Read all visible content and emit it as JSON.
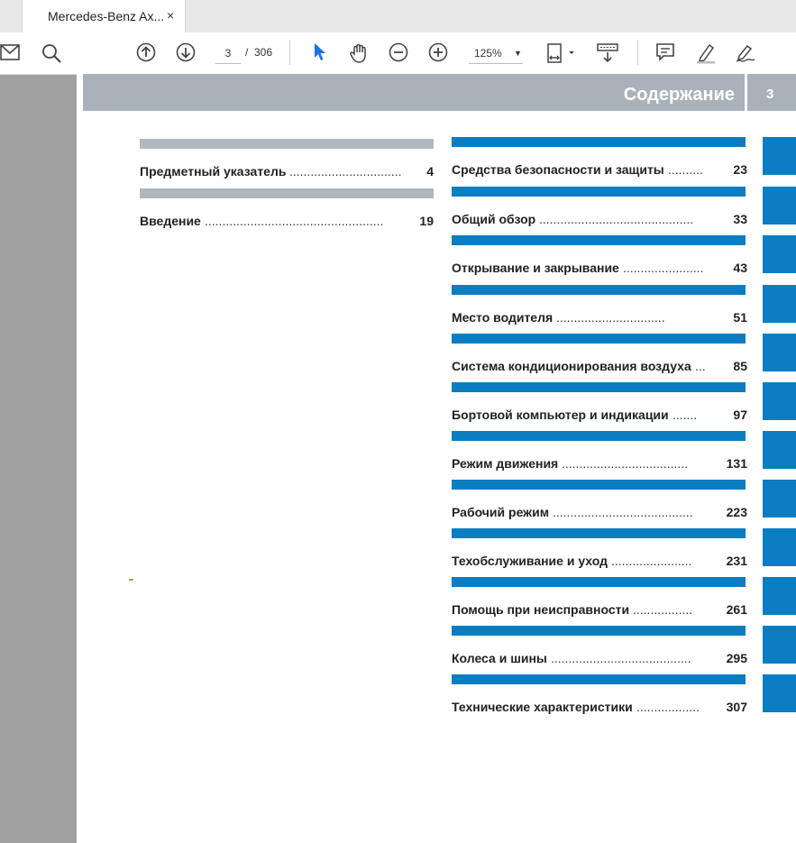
{
  "browser": {
    "tab_title": "Mercedes-Benz Ax...",
    "tab_close": "×"
  },
  "toolbar": {
    "current_page": "3",
    "page_separator": "/",
    "total_pages": "306",
    "zoom": "125%",
    "zoom_caret": "▼",
    "icons": [
      "mail-icon",
      "search-icon",
      "page-up-icon",
      "page-down-icon",
      "select-cursor-icon",
      "hand-tool-icon",
      "zoom-out-icon",
      "zoom-in-icon",
      "page-fit-icon",
      "scroll-mode-icon",
      "comment-icon",
      "highlight-pen-icon",
      "sign-icon"
    ]
  },
  "document": {
    "header_title": "Содержание",
    "page_number": "3",
    "left_entries": [
      {
        "label": "Предметный указатель",
        "dots": "................................",
        "page": "4"
      },
      {
        "label": "Введение",
        "dots": "...................................................",
        "page": "19"
      }
    ],
    "right_entries": [
      {
        "label": "Средства безопасности и защиты",
        "dots": "..........",
        "page": "23"
      },
      {
        "label": "Общий обзор",
        "dots": "............................................",
        "page": "33"
      },
      {
        "label": "Открывание и закрывание",
        "dots": ".......................",
        "page": "43"
      },
      {
        "label": "Место водителя",
        "dots": "...............................",
        "page": "51"
      },
      {
        "label": "Система кондиционирования воздуха",
        "dots": "...",
        "page": "85"
      },
      {
        "label": "Бортовой компьютер и индикации",
        "dots": ".......",
        "page": "97"
      },
      {
        "label": "Режим движения",
        "dots": "....................................",
        "page": "131"
      },
      {
        "label": "Рабочий режим",
        "dots": "........................................",
        "page": "223"
      },
      {
        "label": "Техобслуживание и уход",
        "dots": ".......................",
        "page": "231"
      },
      {
        "label": "Помощь при неисправности",
        "dots": ".................",
        "page": "261"
      },
      {
        "label": "Колеса и шины",
        "dots": "........................................",
        "page": "295"
      },
      {
        "label": "Технические характеристики",
        "dots": "..................",
        "page": "307"
      }
    ],
    "colors": {
      "accent_blue": "#0b7dc2",
      "header_gray": "#a9b2bb",
      "bar_gray": "#b0b7bf"
    }
  }
}
